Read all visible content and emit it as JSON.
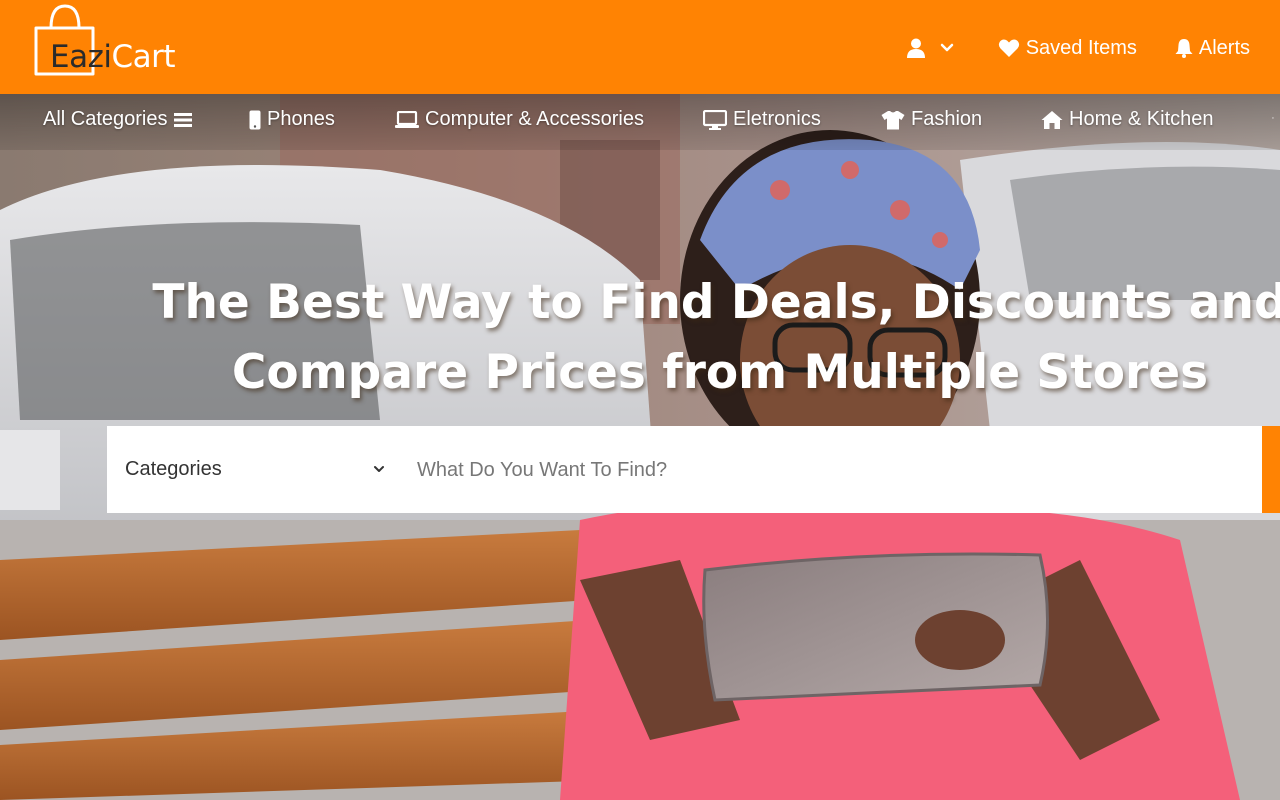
{
  "brand": {
    "logo_part1": "Eazi",
    "logo_part2": "Cart"
  },
  "header": {
    "account_icon": "user-icon",
    "saved_items": "Saved Items",
    "alerts": "Alerts"
  },
  "categories_nav": [
    {
      "label": "All Categories",
      "icon": "menu-bars-icon"
    },
    {
      "label": "Phones",
      "icon": "mobile-phone-icon"
    },
    {
      "label": "Computer & Accessories",
      "icon": "laptop-icon"
    },
    {
      "label": "Eletronics",
      "icon": "desktop-monitor-icon"
    },
    {
      "label": "Fashion",
      "icon": "tshirt-icon"
    },
    {
      "label": "Home & Kitchen",
      "icon": "house-icon"
    }
  ],
  "hero": {
    "headline_line1": "The Best Way to Find Deals, Discounts and",
    "headline_line2": "Compare Prices from Multiple Stores"
  },
  "search": {
    "category_value": "Categories",
    "placeholder": "What Do You Want To Find?"
  },
  "colors": {
    "brand_orange": "#ff8303"
  }
}
